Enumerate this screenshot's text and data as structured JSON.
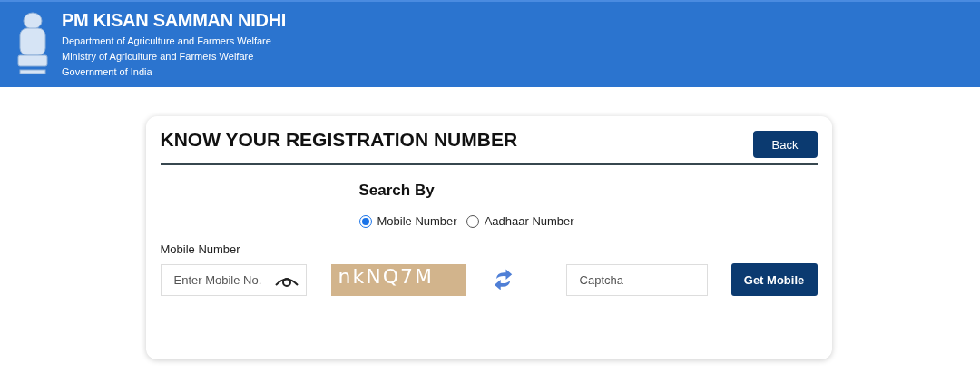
{
  "header": {
    "title": "PM KISAN SAMMAN NIDHI",
    "lines": [
      "Department of Agriculture and Farmers Welfare",
      "Ministry of Agriculture and Farmers Welfare",
      "Government of India"
    ]
  },
  "card": {
    "title": "KNOW YOUR REGISTRATION NUMBER",
    "back_button": "Back",
    "search_by": {
      "label": "Search By",
      "options": [
        {
          "label": "Mobile Number",
          "selected": true
        },
        {
          "label": "Aadhaar Number",
          "selected": false
        }
      ]
    },
    "field_label": "Mobile Number",
    "mobile_field": {
      "placeholder": "Enter Mobile No."
    },
    "captcha_text": "nkNQ7M",
    "captcha_field": {
      "placeholder": "Captcha"
    },
    "submit_button": "Get Mobile"
  }
}
